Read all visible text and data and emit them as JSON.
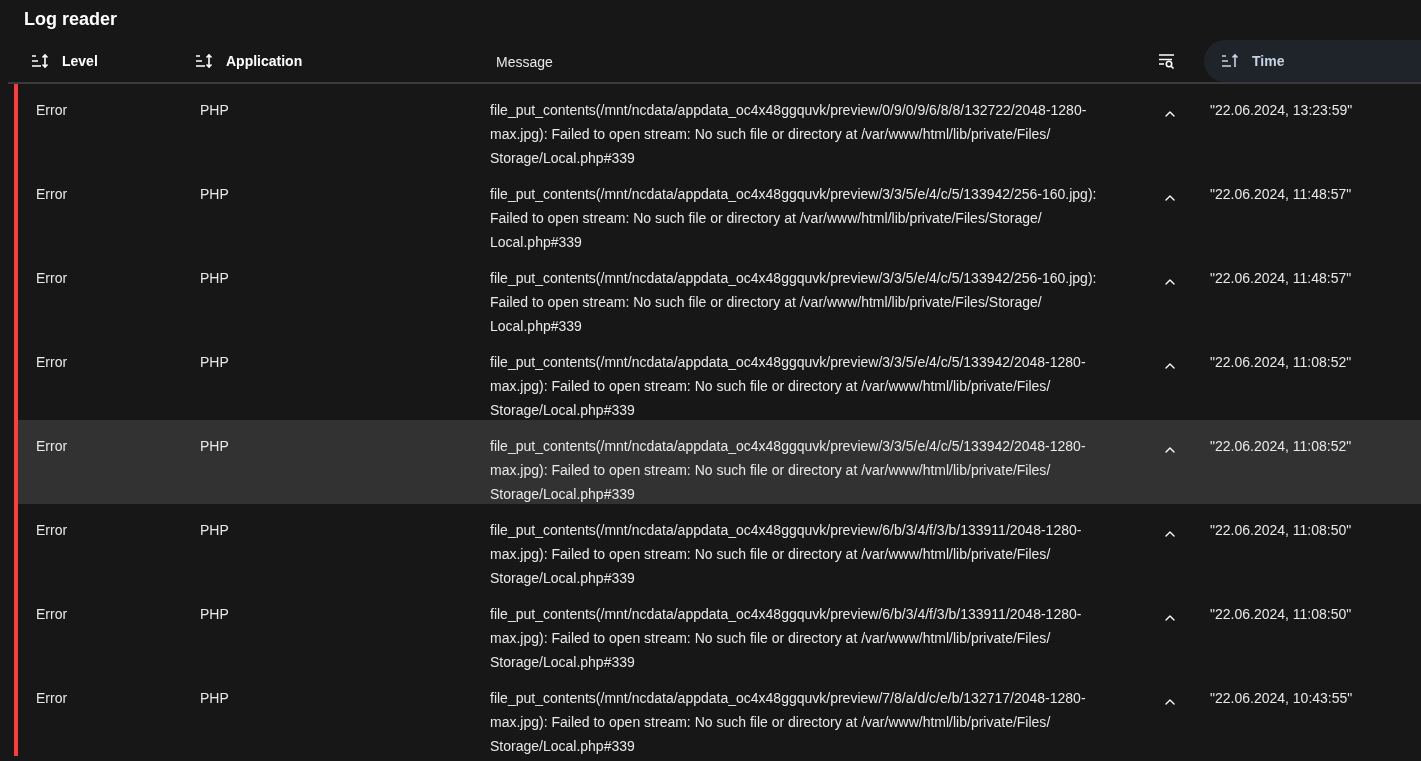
{
  "title": "Log reader",
  "columns": [
    {
      "label": "Level",
      "kind": "sortable",
      "selected": false
    },
    {
      "label": "Application",
      "kind": "sortable",
      "selected": false
    },
    {
      "label": "Message",
      "kind": "filter",
      "selected": false
    },
    {
      "label": "Time",
      "kind": "sorted",
      "selected": true
    }
  ],
  "rows": [
    {
      "level": "Error",
      "color": "#ff3b3b",
      "application": "PHP",
      "message": "file_put_contents(/mnt/ncdata/appdata_oc4x48ggquvk/preview/0/9/0/9/6/8/8/132722/2048-1280-max.jpg): Failed to open stream: No such file or directory at /var/www/html/lib/private/Files/Storage/Local.php#339",
      "time": "\"22.06.2024, 13:23:59\"",
      "selected": false
    },
    {
      "level": "Error",
      "color": "#ff3b3b",
      "application": "PHP",
      "message": "file_put_contents(/mnt/ncdata/appdata_oc4x48ggquvk/preview/3/3/5/e/4/c/5/133942/256-160.jpg): Failed to open stream: No such file or directory at /var/www/html/lib/private/Files/Storage/Local.php#339",
      "time": "\"22.06.2024, 11:48:57\"",
      "selected": false
    },
    {
      "level": "Error",
      "color": "#ff3b3b",
      "application": "PHP",
      "message": "file_put_contents(/mnt/ncdata/appdata_oc4x48ggquvk/preview/3/3/5/e/4/c/5/133942/256-160.jpg): Failed to open stream: No such file or directory at /var/www/html/lib/private/Files/Storage/Local.php#339",
      "time": "\"22.06.2024, 11:48:57\"",
      "selected": false
    },
    {
      "level": "Error",
      "color": "#ff3b3b",
      "application": "PHP",
      "message": "file_put_contents(/mnt/ncdata/appdata_oc4x48ggquvk/preview/3/3/5/e/4/c/5/133942/2048-1280-max.jpg): Failed to open stream: No such file or directory at /var/www/html/lib/private/Files/Storage/Local.php#339",
      "time": "\"22.06.2024, 11:08:52\"",
      "selected": false
    },
    {
      "level": "Error",
      "color": "#ff3b3b",
      "application": "PHP",
      "message": "file_put_contents(/mnt/ncdata/appdata_oc4x48ggquvk/preview/3/3/5/e/4/c/5/133942/2048-1280-max.jpg): Failed to open stream: No such file or directory at /var/www/html/lib/private/Files/Storage/Local.php#339",
      "time": "\"22.06.2024, 11:08:52\"",
      "selected": true
    },
    {
      "level": "Error",
      "color": "#ff3b3b",
      "application": "PHP",
      "message": "file_put_contents(/mnt/ncdata/appdata_oc4x48ggquvk/preview/6/b/3/4/f/3/b/133911/2048-1280-max.jpg): Failed to open stream: No such file or directory at /var/www/html/lib/private/Files/Storage/Local.php#339",
      "time": "\"22.06.2024, 11:08:50\"",
      "selected": false
    },
    {
      "level": "Error",
      "color": "#ff3b3b",
      "application": "PHP",
      "message": "file_put_contents(/mnt/ncdata/appdata_oc4x48ggquvk/preview/6/b/3/4/f/3/b/133911/2048-1280-max.jpg): Failed to open stream: No such file or directory at /var/www/html/lib/private/Files/Storage/Local.php#339",
      "time": "\"22.06.2024, 11:08:50\"",
      "selected": false
    },
    {
      "level": "Error",
      "color": "#ff3b3b",
      "application": "PHP",
      "message": "file_put_contents(/mnt/ncdata/appdata_oc4x48ggquvk/preview/7/8/a/d/c/e/b/132717/2048-1280-max.jpg): Failed to open stream: No such file or directory at /var/www/html/lib/private/Files/Storage/Local.php#339",
      "time": "\"22.06.2024, 10:43:55\"",
      "selected": false
    }
  ]
}
